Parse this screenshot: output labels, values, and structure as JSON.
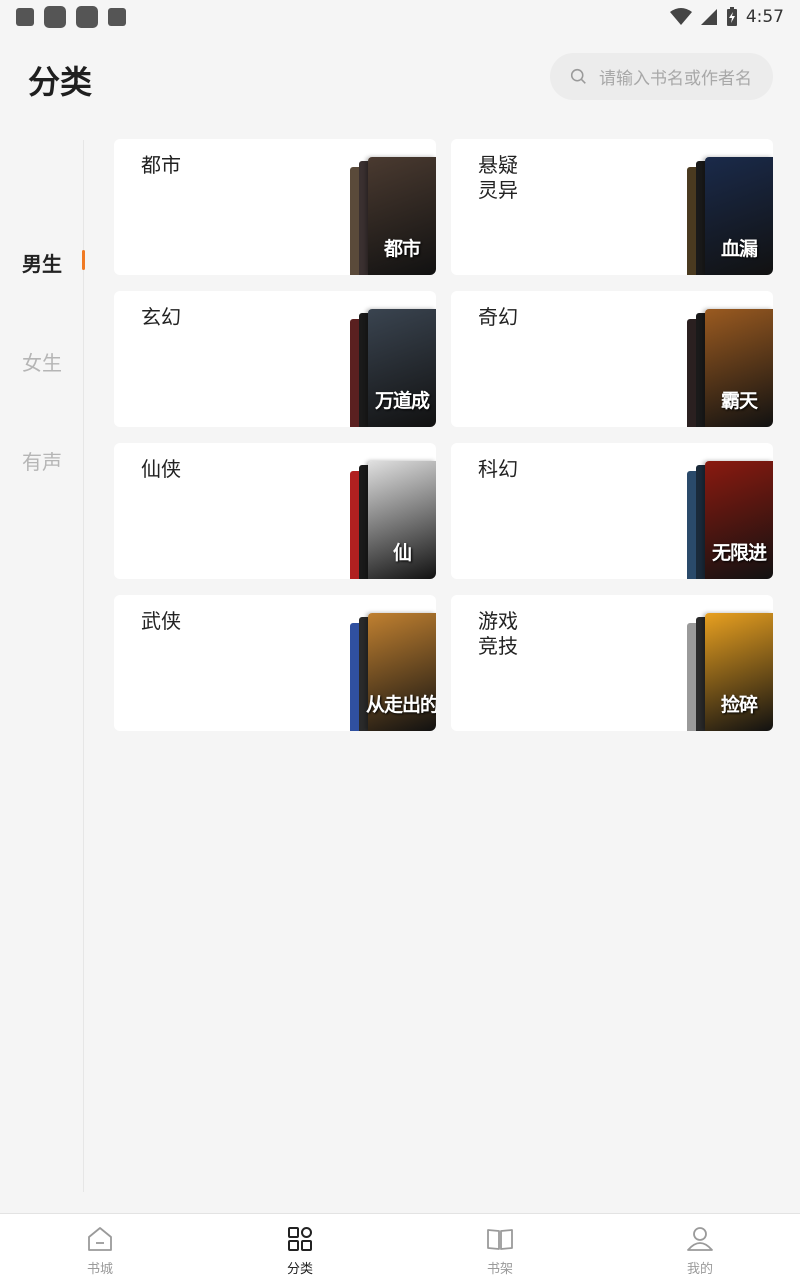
{
  "status_bar": {
    "time": "4:57"
  },
  "header": {
    "title": "分类"
  },
  "search": {
    "placeholder": "请输入书名或作者名"
  },
  "left_nav": {
    "items": [
      {
        "label": "男生",
        "active": true
      },
      {
        "label": "女生",
        "active": false
      },
      {
        "label": "有声",
        "active": false
      }
    ]
  },
  "categories": [
    {
      "label": "都市",
      "cover_title": "都市",
      "colors": [
        "#5a4a3a",
        "#3a3030",
        "#4a3a30"
      ]
    },
    {
      "label": "悬疑\n灵异",
      "cover_title": "血漏",
      "colors": [
        "#4a3a20",
        "#1a1a1a",
        "#1a2a4a"
      ]
    },
    {
      "label": "玄幻",
      "cover_title": "万道成",
      "colors": [
        "#5a2020",
        "#1a1a1a",
        "#3a4450"
      ]
    },
    {
      "label": "奇幻",
      "cover_title": "霸天",
      "colors": [
        "#2a2020",
        "#1a1a1a",
        "#9a5a20"
      ]
    },
    {
      "label": "仙侠",
      "cover_title": "仙",
      "colors": [
        "#b02020",
        "#1a1a1a",
        "#e0e0e0"
      ]
    },
    {
      "label": "科幻",
      "cover_title": "无限进",
      "colors": [
        "#2a4a6a",
        "#1a2a3a",
        "#8a1a10"
      ]
    },
    {
      "label": "武侠",
      "cover_title": "从走出的",
      "colors": [
        "#3050a0",
        "#2a2a2a",
        "#c08030"
      ]
    },
    {
      "label": "游戏\n竞技",
      "cover_title": "捡碎",
      "colors": [
        "#9a9a9a",
        "#2a2a2a",
        "#e8a020"
      ]
    }
  ],
  "tab_bar": {
    "tabs": [
      {
        "label": "书城",
        "icon": "home-icon",
        "active": false
      },
      {
        "label": "分类",
        "icon": "grid-icon",
        "active": true
      },
      {
        "label": "书架",
        "icon": "book-icon",
        "active": false
      },
      {
        "label": "我的",
        "icon": "user-icon",
        "active": false
      }
    ]
  },
  "colors": {
    "accent": "#f07a24",
    "background": "#f5f5f5",
    "card": "#ffffff"
  }
}
